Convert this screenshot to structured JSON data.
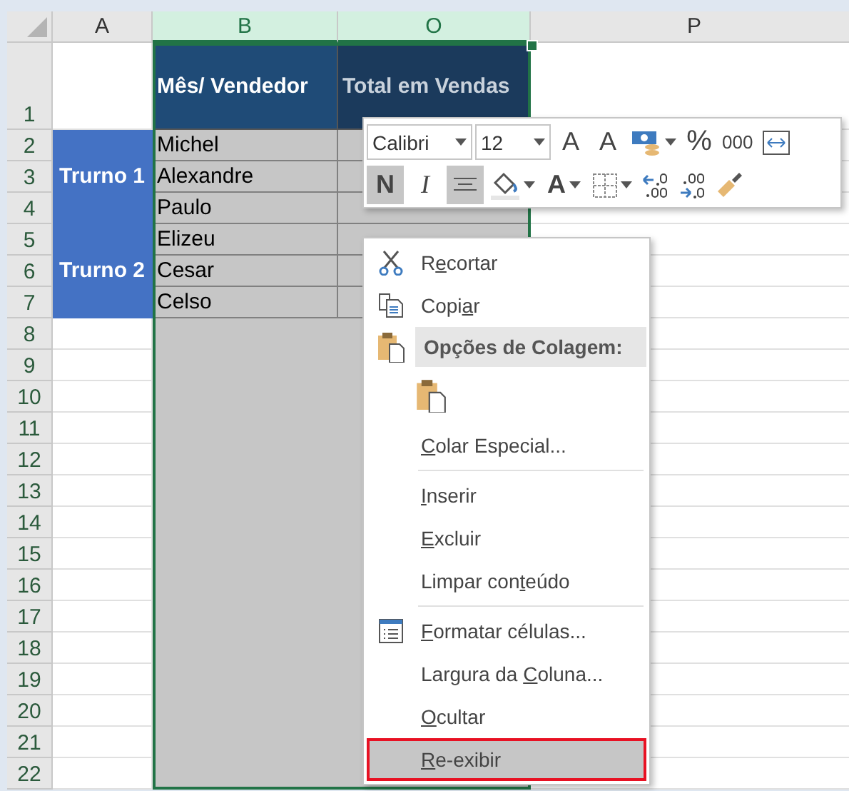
{
  "columns": [
    {
      "label": "A",
      "selected": false
    },
    {
      "label": "B",
      "selected": true
    },
    {
      "label": "O",
      "selected": true
    },
    {
      "label": "P",
      "selected": false
    }
  ],
  "header_row": {
    "number": "1",
    "vendor": "Mês/ Vendedor",
    "total": "Total em Vendas"
  },
  "groups": [
    {
      "label": "Trurno 1",
      "rows": [
        {
          "number": "2",
          "vendor": "Michel"
        },
        {
          "number": "3",
          "vendor": "Alexandre"
        },
        {
          "number": "4",
          "vendor": "Paulo"
        }
      ]
    },
    {
      "label": "Trurno 2",
      "rows": [
        {
          "number": "5",
          "vendor": "Elizeu"
        },
        {
          "number": "6",
          "vendor": "Cesar"
        },
        {
          "number": "7",
          "vendor": "Celso"
        }
      ]
    }
  ],
  "empty_rows": [
    "8",
    "9",
    "10",
    "11",
    "12",
    "13",
    "14",
    "15",
    "16",
    "17",
    "18",
    "19",
    "20",
    "21",
    "22"
  ],
  "mini_toolbar": {
    "font": "Calibri",
    "size": "12",
    "row_1": [
      {
        "kind": "grow",
        "label": "A"
      },
      {
        "kind": "shrink",
        "label": "A"
      },
      {
        "kind": "currency"
      },
      {
        "kind": "text",
        "label": "%"
      },
      {
        "kind": "text",
        "label": "000"
      },
      {
        "kind": "wrap"
      }
    ],
    "row_2": [
      {
        "kind": "bold",
        "label": "N",
        "on": true
      },
      {
        "kind": "italic",
        "label": "I",
        "on": false
      },
      {
        "kind": "center",
        "on": true
      },
      {
        "kind": "fill"
      },
      {
        "kind": "font-color",
        "label": "A"
      },
      {
        "kind": "borders"
      },
      {
        "kind": "more-decimals"
      },
      {
        "kind": "fewer-decimals"
      },
      {
        "kind": "painter"
      }
    ]
  },
  "context_menu": [
    {
      "kind": "cut",
      "pre": "R",
      "key": "e",
      "post": "cortar",
      "selected": false
    },
    {
      "kind": "copy",
      "pre": "Copi",
      "key": "a",
      "post": "r",
      "selected": false
    },
    {
      "kind": "paste-header",
      "pre": "Opções de Colagem:",
      "selected": false
    },
    {
      "kind": "paste-option",
      "selected": false
    },
    {
      "kind": "command",
      "key": "C",
      "post": "olar Especial...",
      "selected": false
    },
    {
      "kind": "separator"
    },
    {
      "kind": "command",
      "key": "I",
      "post": "nserir",
      "selected": false
    },
    {
      "kind": "command",
      "key": "E",
      "post": "xcluir",
      "selected": false
    },
    {
      "kind": "command",
      "pre": "Limpar con",
      "key": "t",
      "post": "eúdo",
      "selected": false
    },
    {
      "kind": "separator"
    },
    {
      "kind": "format",
      "key": "F",
      "post": "ormatar células...",
      "selected": false
    },
    {
      "kind": "command",
      "pre": "Largura da ",
      "key": "C",
      "post": "oluna...",
      "selected": false
    },
    {
      "kind": "command",
      "key": "O",
      "post": "cultar",
      "selected": false
    },
    {
      "kind": "command",
      "key": "R",
      "post": "e-exibir",
      "selected": true
    }
  ]
}
